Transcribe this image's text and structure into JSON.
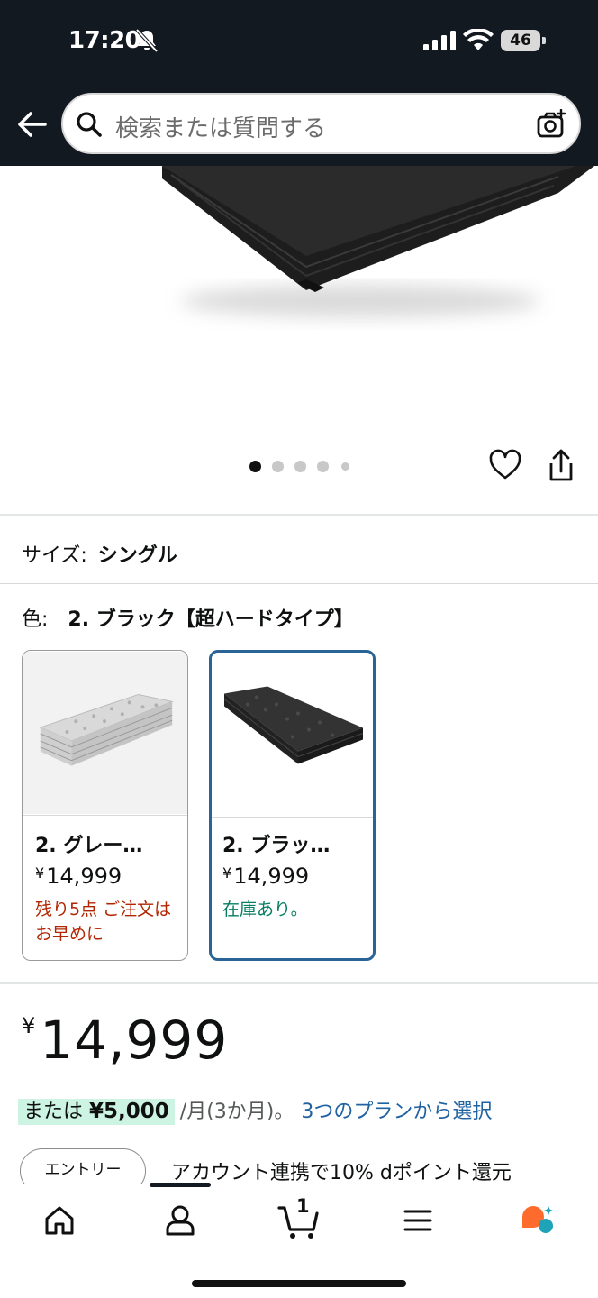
{
  "status_bar": {
    "time": "17:20",
    "battery": "46"
  },
  "search": {
    "placeholder": "検索または質問する"
  },
  "size_row": {
    "label": "サイズ:",
    "value": "シングル"
  },
  "color_row": {
    "label": "色:",
    "value": "2. ブラック【超ハードタイプ】"
  },
  "swatches": [
    {
      "title": "2. グレー…",
      "currency": "¥",
      "price": "14,999",
      "stock": "残り5点 ご注文はお早めに",
      "stock_status": "low",
      "selected": false
    },
    {
      "title": "2. ブラッ…",
      "currency": "¥",
      "price": "14,999",
      "stock": "在庫あり。",
      "stock_status": "in_stock",
      "selected": true
    }
  ],
  "price": {
    "currency": "¥",
    "amount": "14,999"
  },
  "installment": {
    "prefix": "または",
    "amount": "¥5,000",
    "suffix": "/月(3か月)。",
    "plan_link": "3つのプランから選択"
  },
  "promo": {
    "entry_button": "エントリー",
    "text": "アカウント連携で10% dポイント還元"
  },
  "carousel": {
    "total": 5,
    "active": 1
  },
  "cart": {
    "count": "1"
  },
  "bottom_nav": {
    "items": [
      "home-icon",
      "account-icon",
      "cart-icon",
      "menu-icon",
      "rufus-icon"
    ]
  },
  "colors": {
    "header_bg": "#131921",
    "price_green_bg": "#cdf3e3",
    "link_blue": "#2162a1",
    "stock_red": "#b12704",
    "stock_green": "#067d62",
    "selected_border": "#2a6496",
    "rufus_orange": "#ff6b2c",
    "rufus_teal": "#1fa3b8"
  }
}
